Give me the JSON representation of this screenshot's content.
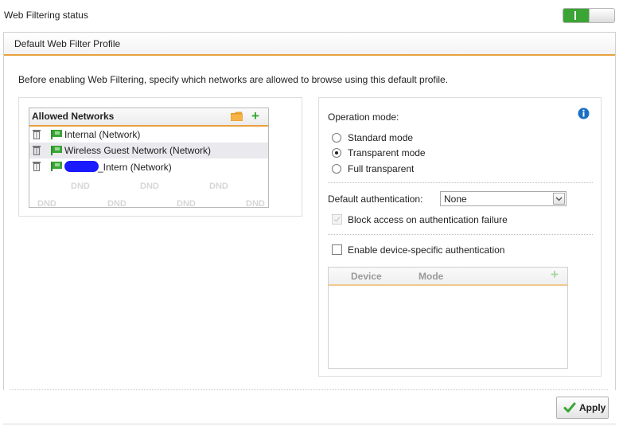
{
  "status": {
    "label": "Web Filtering status",
    "toggle_on": true
  },
  "profile": {
    "title": "Default Web Filter Profile",
    "intro": "Before enabling Web Filtering, specify which networks are allowed to browse using this default profile."
  },
  "networks": {
    "title": "Allowed Networks",
    "items": [
      {
        "label": "Internal (Network)"
      },
      {
        "label": "Wireless Guest Network (Network)"
      },
      {
        "label": "_Intern (Network)"
      }
    ],
    "dnd_label": "DND"
  },
  "operation": {
    "label": "Operation mode:",
    "modes": [
      "Standard mode",
      "Transparent mode",
      "Full transparent"
    ],
    "selected": "Transparent mode"
  },
  "auth": {
    "label": "Default authentication:",
    "value": "None",
    "block_label": "Block access on authentication failure",
    "block_checked": false,
    "device_specific_label": "Enable device-specific authentication",
    "device_specific_checked": false
  },
  "device_table": {
    "columns": [
      "Device",
      "Mode"
    ]
  },
  "actions": {
    "apply_label": "Apply"
  },
  "colors": {
    "accent": "#e8a13c",
    "green": "#3aa535",
    "info": "#1b6fc4"
  }
}
